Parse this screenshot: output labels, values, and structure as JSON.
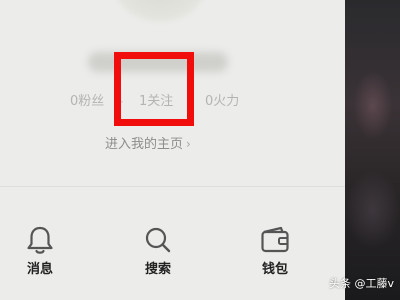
{
  "profile": {
    "stats": {
      "fans": "0粉丝",
      "following": "1关注",
      "fire": "0火力",
      "separator": "·"
    },
    "homepage_link": "进入我的主页",
    "homepage_chevron": "›"
  },
  "annotation": {
    "highlight_color": "#f20d0d"
  },
  "bottom_nav": {
    "items": [
      {
        "label": "消息",
        "icon": "bell-icon"
      },
      {
        "label": "搜索",
        "icon": "search-icon"
      },
      {
        "label": "钱包",
        "icon": "wallet-icon"
      }
    ]
  },
  "watermark": "头条 @工藤v"
}
